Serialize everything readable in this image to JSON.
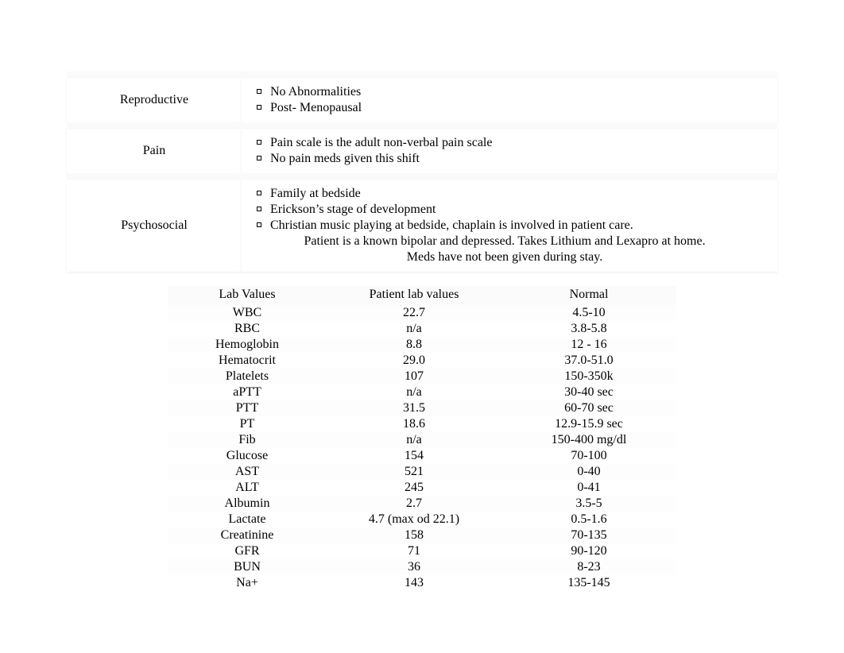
{
  "sections": [
    {
      "title": "Reproductive",
      "bullets": [
        "No Abnormalities",
        "Post- Menopausal"
      ],
      "extra": []
    },
    {
      "title": "Pain",
      "bullets": [
        "Pain scale is the adult non-verbal pain scale",
        "No pain meds given this shift"
      ],
      "extra": []
    },
    {
      "title": "Psychosocial",
      "bullets": [
        "Family at bedside",
        "Erickson’s stage of development",
        "Christian music playing at bedside, chaplain is involved in patient care."
      ],
      "extra": [
        "Patient is a known bipolar and depressed. Takes Lithium and Lexapro at home.",
        "Meds have not been given during stay."
      ]
    }
  ],
  "lab": {
    "headers": {
      "c1": "Lab Values",
      "c2": "Patient lab values",
      "c3": "Normal"
    },
    "rows": [
      {
        "name": "WBC",
        "value": "22.7",
        "normal": "4.5-10"
      },
      {
        "name": "RBC",
        "value": "n/a",
        "normal": "3.8-5.8"
      },
      {
        "name": "Hemoglobin",
        "value": "8.8",
        "normal": "12 - 16"
      },
      {
        "name": "Hematocrit",
        "value": "29.0",
        "normal": "37.0-51.0"
      },
      {
        "name": "Platelets",
        "value": "107",
        "normal": "150-350k"
      },
      {
        "name": "aPTT",
        "value": "n/a",
        "normal": "30-40 sec"
      },
      {
        "name": "PTT",
        "value": "31.5",
        "normal": "60-70 sec"
      },
      {
        "name": "PT",
        "value": "18.6",
        "normal": "12.9-15.9 sec"
      },
      {
        "name": "Fib",
        "value": "n/a",
        "normal": "150-400 mg/dl"
      },
      {
        "name": "Glucose",
        "value": "154",
        "normal": "70-100"
      },
      {
        "name": "AST",
        "value": "521",
        "normal": "0-40"
      },
      {
        "name": "ALT",
        "value": "245",
        "normal": "0-41"
      },
      {
        "name": "Albumin",
        "value": "2.7",
        "normal": "3.5-5"
      },
      {
        "name": "Lactate",
        "value": "4.7 (max od 22.1)",
        "normal": "0.5-1.6"
      },
      {
        "name": "Creatinine",
        "value": "158",
        "normal": "70-135"
      },
      {
        "name": "GFR",
        "value": "71",
        "normal": "90-120"
      },
      {
        "name": "BUN",
        "value": "36",
        "normal": "8-23"
      },
      {
        "name": "Na+",
        "value": "143",
        "normal": "135-145"
      }
    ]
  }
}
